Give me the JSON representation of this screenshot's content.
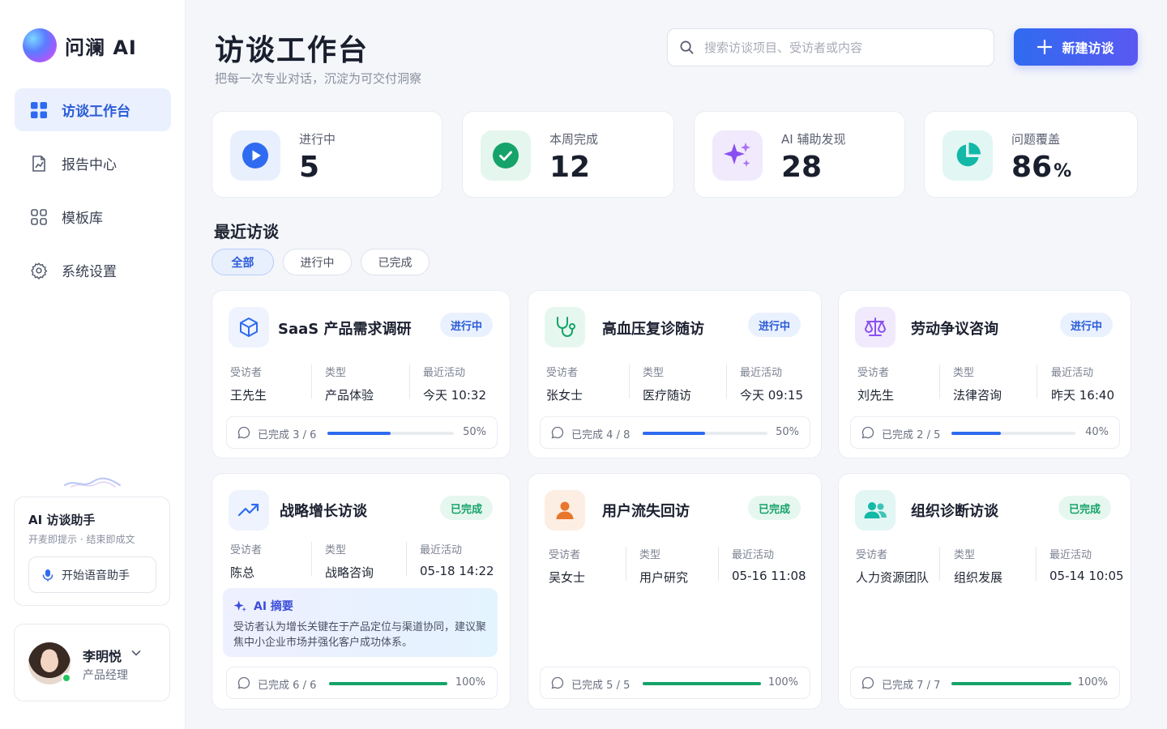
{
  "app": {
    "name": "问澜 AI"
  },
  "nav": {
    "items": [
      {
        "label": "访谈工作台",
        "active": true,
        "icon": "dashboard-grid-icon"
      },
      {
        "label": "报告中心",
        "active": false,
        "icon": "report-chart-icon"
      },
      {
        "label": "模板库",
        "active": false,
        "icon": "template-grid-icon"
      },
      {
        "label": "系统设置",
        "active": false,
        "icon": "gear-icon"
      }
    ]
  },
  "assistant": {
    "title": "AI 访谈助手",
    "subtitle": "开麦即提示 · 结束即成文",
    "button_label": "开始语音助手"
  },
  "user": {
    "name": "李明悦",
    "role": "产品经理",
    "online": true
  },
  "header": {
    "title": "访谈工作台",
    "subtitle": "把每一次专业对话，沉淀为可交付洞察",
    "search_placeholder": "搜索访谈项目、受访者或内容",
    "new_button": "新建访谈"
  },
  "stats": [
    {
      "label": "进行中",
      "value": "5",
      "unit": "",
      "icon": "play-icon",
      "color": "#2f6bf0"
    },
    {
      "label": "本周完成",
      "value": "12",
      "unit": "",
      "icon": "check-circle-icon",
      "color": "#16a36a"
    },
    {
      "label": "AI 辅助发现",
      "value": "28",
      "unit": "",
      "icon": "sparkle-icon",
      "color": "#8a4ff0"
    },
    {
      "label": "问题覆盖",
      "value": "86",
      "unit": "%",
      "icon": "pie-chart-icon",
      "color": "#14b8a6"
    }
  ],
  "recent": {
    "title": "最近访谈",
    "filters": [
      {
        "label": "全部",
        "active": true
      },
      {
        "label": "进行中",
        "active": false
      },
      {
        "label": "已完成",
        "active": false
      }
    ],
    "meta_labels": {
      "interviewee": "受访者",
      "type": "类型",
      "activity": "最近活动"
    },
    "progress_prefix": "已完成",
    "cards": [
      {
        "title": "SaaS 产品需求调研",
        "status": "进行中",
        "interviewee": "王先生",
        "type": "产品体验",
        "activity": "今天 10:32",
        "done": "3",
        "total": "6",
        "percent": "50%",
        "progress": 0.5,
        "icon": "cube-icon"
      },
      {
        "title": "高血压复诊随访",
        "status": "进行中",
        "interviewee": "张女士",
        "type": "医疗随访",
        "activity": "今天 09:15",
        "done": "4",
        "total": "8",
        "percent": "50%",
        "progress": 0.5,
        "icon": "stethoscope-icon"
      },
      {
        "title": "劳动争议咨询",
        "status": "进行中",
        "interviewee": "刘先生",
        "type": "法律咨询",
        "activity": "昨天 16:40",
        "done": "2",
        "total": "5",
        "percent": "40%",
        "progress": 0.4,
        "icon": "scales-icon"
      },
      {
        "title": "战略增长访谈",
        "status": "已完成",
        "interviewee": "陈总",
        "type": "战略咨询",
        "activity": "05-18 14:22",
        "done": "6",
        "total": "6",
        "percent": "100%",
        "progress": 1.0,
        "icon": "trend-up-icon",
        "ai_summary": {
          "title": "AI 摘要",
          "text": "受访者认为增长关键在于产品定位与渠道协同，建议聚焦中小企业市场并强化客户成功体系。"
        }
      },
      {
        "title": "用户流失回访",
        "status": "已完成",
        "interviewee": "吴女士",
        "type": "用户研究",
        "activity": "05-16 11:08",
        "done": "5",
        "total": "5",
        "percent": "100%",
        "progress": 1.0,
        "icon": "person-icon"
      },
      {
        "title": "组织诊断访谈",
        "status": "已完成",
        "interviewee": "人力资源团队",
        "type": "组织发展",
        "activity": "05-14 10:05",
        "done": "7",
        "total": "7",
        "percent": "100%",
        "progress": 1.0,
        "icon": "team-icon"
      }
    ]
  }
}
